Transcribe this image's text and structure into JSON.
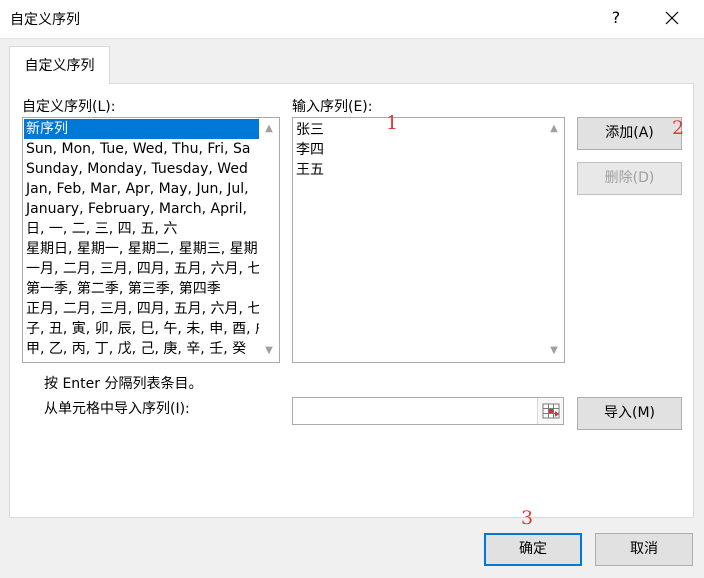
{
  "window": {
    "title": "自定义序列",
    "help_icon": "?",
    "close_icon": "close-icon"
  },
  "tab": {
    "label": "自定义序列"
  },
  "list_label": "自定义序列(L):",
  "list_items": [
    "新序列",
    "Sun, Mon, Tue, Wed, Thu, Fri, Sa",
    "Sunday, Monday, Tuesday, Wed",
    "Jan, Feb, Mar, Apr, May, Jun, Jul,",
    "January, February, March, April,",
    "日, 一, 二, 三, 四, 五, 六",
    "星期日, 星期一, 星期二, 星期三, 星期",
    "一月, 二月, 三月, 四月, 五月, 六月, 七",
    "第一季, 第二季, 第三季, 第四季",
    "正月, 二月, 三月, 四月, 五月, 六月, 七",
    "子, 丑, 寅, 卯, 辰, 巳, 午, 未, 申, 酉, 戌",
    "甲, 乙, 丙, 丁, 戊, 己, 庚, 辛, 壬, 癸"
  ],
  "selected_index": 0,
  "entries_label": "输入序列(E):",
  "entries": [
    "张三",
    "李四",
    "王五"
  ],
  "buttons": {
    "add": "添加(A)",
    "delete": "删除(D)",
    "import": "导入(M)",
    "ok": "确定",
    "cancel": "取消"
  },
  "hint": "按 Enter 分隔列表条目。",
  "import_label": "从单元格中导入序列(I):",
  "import_value": "",
  "annotations": [
    "1",
    "2",
    "3"
  ],
  "colors": {
    "selection": "#0078d7",
    "annotation": "#e03c3c"
  }
}
